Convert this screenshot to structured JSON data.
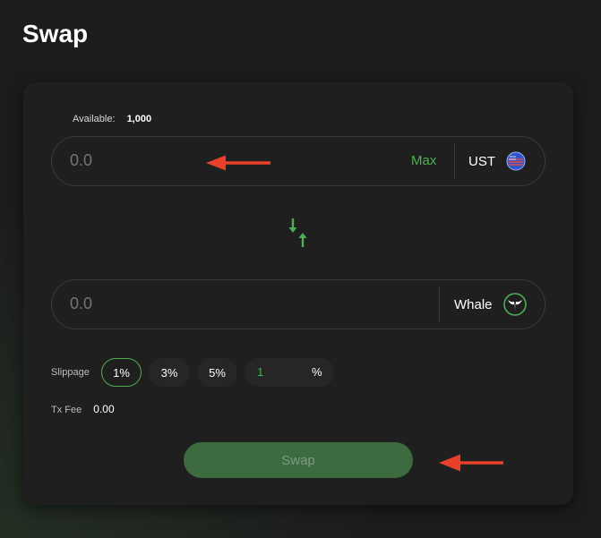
{
  "page": {
    "title": "Swap"
  },
  "swap_form": {
    "available_label": "Available:",
    "available_value": "1,000",
    "from": {
      "amount_placeholder": "0.0",
      "max_label": "Max",
      "token": "UST",
      "token_icon": "us-flag-globe-icon"
    },
    "to": {
      "amount_placeholder": "0.0",
      "token": "Whale",
      "token_icon": "whale-tail-icon"
    },
    "direction_icon": "swap-direction-icon",
    "slippage": {
      "label": "Slippage",
      "options": [
        "1%",
        "3%",
        "5%"
      ],
      "selected": "1%",
      "custom_value": "1",
      "custom_unit": "%"
    },
    "tx_fee": {
      "label": "Tx Fee",
      "value": "0.00"
    },
    "submit_label": "Swap"
  },
  "annotations": {
    "arrow_color": "#e8402a"
  },
  "colors": {
    "accent": "#4caf50",
    "button_bg": "#3d6b40"
  }
}
